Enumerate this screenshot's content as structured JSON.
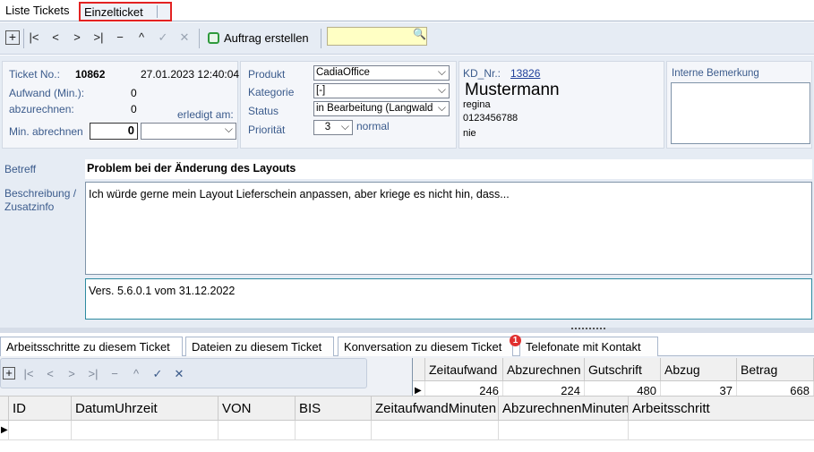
{
  "tabs": {
    "list": "Liste Tickets",
    "single": "Einzelticket"
  },
  "toolbar": {
    "order_label": "Auftrag erstellen",
    "search_value": ""
  },
  "ticket": {
    "no_label": "Ticket No.:",
    "no": "10862",
    "datetime": "27.01.2023 12:40:04",
    "effort_label": "Aufwand (Min.):",
    "effort": "0",
    "bill_label": "abzurechnen:",
    "bill": "0",
    "done_label": "erledigt am:",
    "done_value": "",
    "min_bill_label": "Min. abrechnen",
    "min_bill": "0"
  },
  "product": {
    "product_label": "Produkt",
    "product": "CadiaOffice",
    "category_label": "Kategorie",
    "category": "[-]",
    "status_label": "Status",
    "status": "in Bearbeitung (Langwald",
    "priority_label": "Priorität",
    "priority": "3",
    "priority_text": "normal"
  },
  "customer": {
    "kd_label": "KD_Nr.:",
    "kd_no": "13826",
    "name": "Mustermann",
    "first": "regina",
    "phone": "0123456788",
    "extra": "nie"
  },
  "remark": {
    "label": "Interne Bemerkung",
    "value": ""
  },
  "subject": {
    "label": "Betreff",
    "value": "Problem bei der Änderung des Layouts"
  },
  "description": {
    "label_1": "Beschreibung /",
    "label_2": "Zusatzinfo",
    "text": "Ich würde gerne mein Layout Lieferschein anpassen, aber kriege es nicht hin, dass...",
    "version": "Vers. 5.6.0.1 vom 31.12.2022"
  },
  "bottom_tabs": {
    "work": "Arbeitsschritte zu diesem Ticket",
    "files": "Dateien zu diesem Ticket",
    "conv": "Konversation zu diesem Ticket",
    "calls": "Telefonate mit Kontakt",
    "badge": "1"
  },
  "summary": {
    "headers": [
      "Zeitaufwand",
      "Abzurechnen",
      "Gutschrift",
      "Abzug",
      "Betrag"
    ],
    "values": [
      "246",
      "224",
      "480",
      "37",
      "668"
    ]
  },
  "detail": {
    "headers": [
      "ID",
      "DatumUhrzeit",
      "VON",
      "BIS",
      "ZeitaufwandMinuten",
      "AbzurechnenMinuten",
      "Arbeitsschritt"
    ]
  },
  "icons": {
    "add": "+",
    "first": "|<",
    "prev": "<",
    "next": ">",
    "last": ">|",
    "delete": "−",
    "up": "^",
    "save": "✓",
    "cancel": "✕"
  }
}
